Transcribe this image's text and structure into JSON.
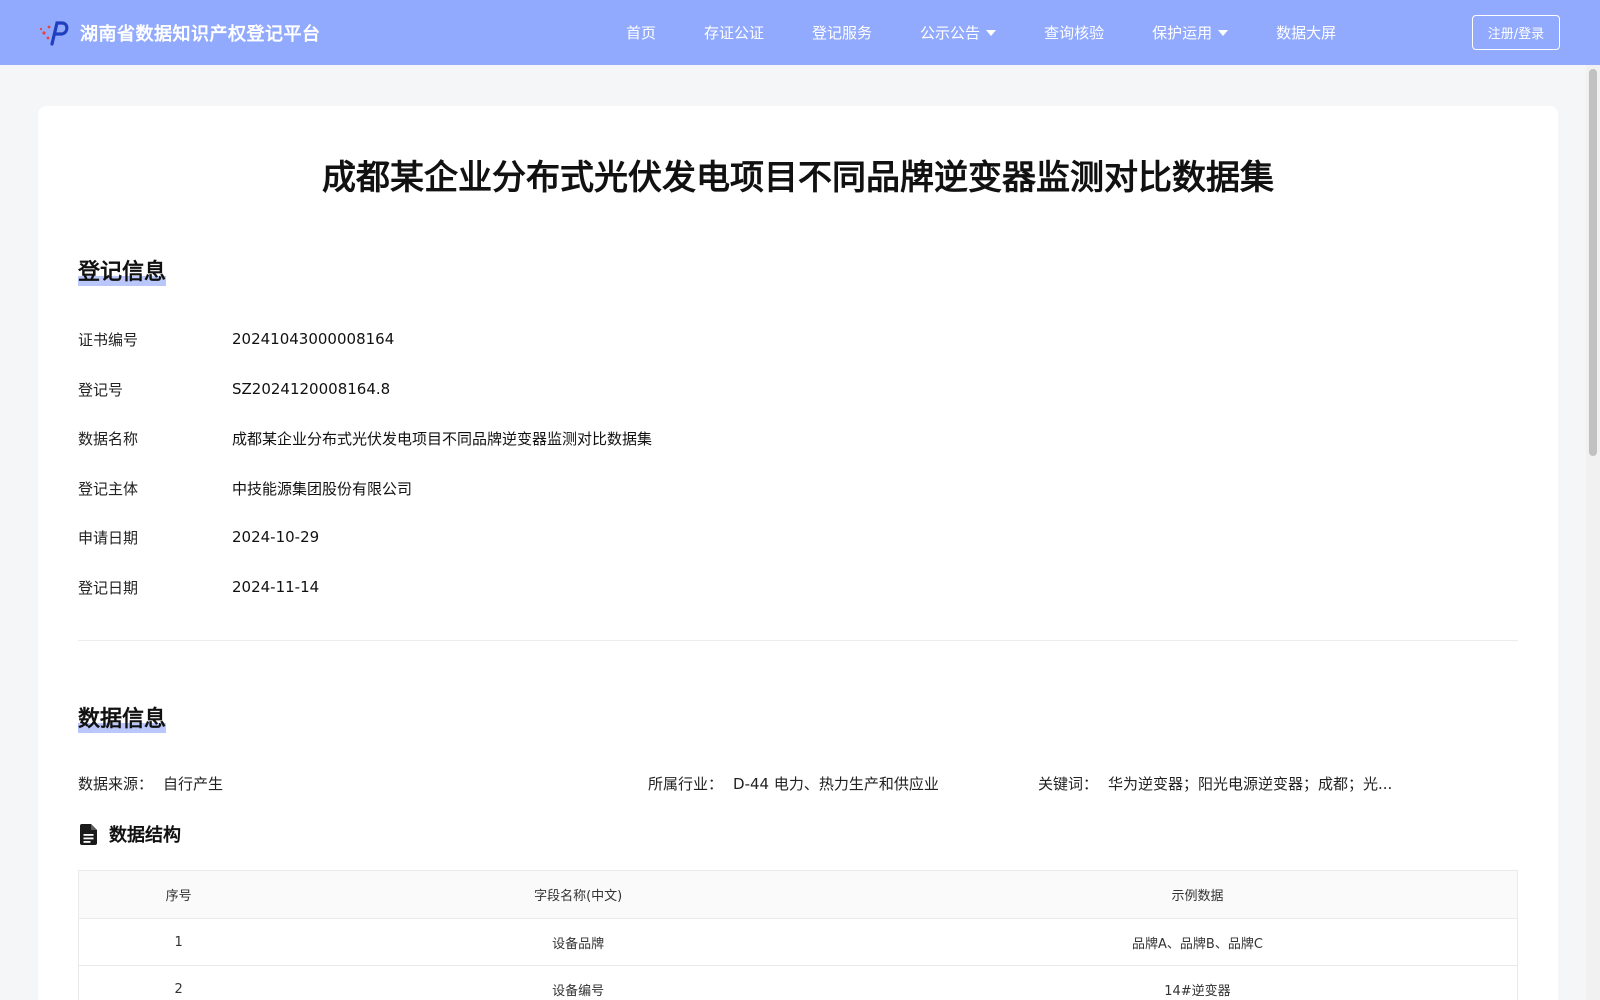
{
  "header": {
    "logo_text": "湖南省数据知识产权登记平台",
    "nav": [
      {
        "label": "首页",
        "has_dropdown": false
      },
      {
        "label": "存证公证",
        "has_dropdown": false
      },
      {
        "label": "登记服务",
        "has_dropdown": false
      },
      {
        "label": "公示公告",
        "has_dropdown": true
      },
      {
        "label": "查询核验",
        "has_dropdown": false
      },
      {
        "label": "保护运用",
        "has_dropdown": true
      },
      {
        "label": "数据大屏",
        "has_dropdown": false
      }
    ],
    "login_label": "注册/登录",
    "background_color": "#92aafe"
  },
  "page": {
    "title": "成都某企业分布式光伏发电项目不同品牌逆变器监测对比数据集"
  },
  "registration": {
    "section_title": "登记信息",
    "rows": [
      {
        "label": "证书编号",
        "value": "20241043000008164"
      },
      {
        "label": "登记号",
        "value": "SZ2024120008164.8"
      },
      {
        "label": "数据名称",
        "value": "成都某企业分布式光伏发电项目不同品牌逆变器监测对比数据集"
      },
      {
        "label": "登记主体",
        "value": "中技能源集团股份有限公司"
      },
      {
        "label": "申请日期",
        "value": "2024-10-29"
      },
      {
        "label": "登记日期",
        "value": "2024-11-14"
      }
    ]
  },
  "data_info": {
    "section_title": "数据信息",
    "source_label": "数据来源：",
    "source_value": "自行产生",
    "industry_label": "所属行业：",
    "industry_value": "D-44 电力、热力生产和供应业",
    "keywords_label": "关键词：",
    "keywords_value": "华为逆变器；阳光电源逆变器；成都；光...",
    "structure_title": "数据结构",
    "structure_icon": "document-icon",
    "table": {
      "headers": [
        "序号",
        "字段名称(中文)",
        "示例数据"
      ],
      "rows": [
        [
          "1",
          "设备品牌",
          "品牌A、品牌B、品牌C"
        ],
        [
          "2",
          "设备编号",
          "14#逆变器"
        ]
      ]
    }
  }
}
